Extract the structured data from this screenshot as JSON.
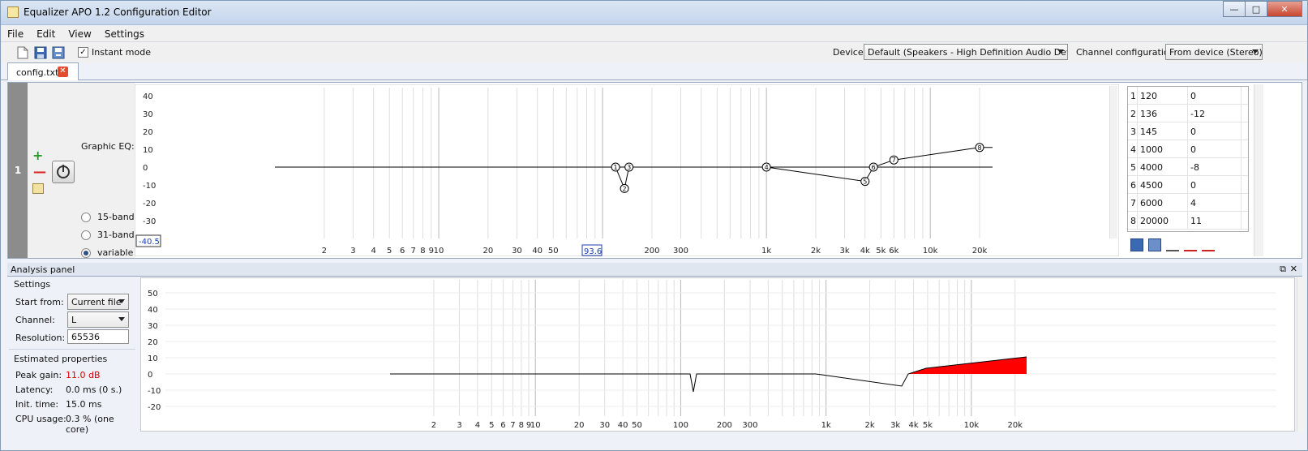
{
  "window": {
    "title": "Equalizer APO 1.2 Configuration Editor"
  },
  "menu": [
    "File",
    "Edit",
    "View",
    "Settings"
  ],
  "toolbar": {
    "instant_mode": "Instant mode",
    "device_label": "Device:",
    "device_value": "Default (Speakers - High Definition Audio Device)",
    "channel_label": "Channel configuration:",
    "channel_value": "From device (Stereo)"
  },
  "tab": {
    "name": "config.txt"
  },
  "filter": {
    "index": "1",
    "type_label": "Graphic EQ:",
    "radios": [
      "15-band",
      "31-band",
      "variable"
    ],
    "selected": "variable",
    "floor_value": "-40.5",
    "cursor_value": "93.6",
    "y_ticks": [
      "40",
      "30",
      "20",
      "10",
      "0",
      "-10",
      "-20",
      "-30"
    ],
    "x_ticks": [
      "2",
      "3",
      "4",
      "5",
      "6",
      "7",
      "8",
      "9",
      "10",
      "20",
      "30",
      "40",
      "50",
      "200",
      "300",
      "1k",
      "2k",
      "3k",
      "4k",
      "5k",
      "6k",
      "10k",
      "20k"
    ],
    "points": [
      {
        "n": 1,
        "freq": "120",
        "gain": "0"
      },
      {
        "n": 2,
        "freq": "136",
        "gain": "-12"
      },
      {
        "n": 3,
        "freq": "145",
        "gain": "0"
      },
      {
        "n": 4,
        "freq": "1000",
        "gain": "0"
      },
      {
        "n": 5,
        "freq": "4000",
        "gain": "-8"
      },
      {
        "n": 6,
        "freq": "4500",
        "gain": "0"
      },
      {
        "n": 7,
        "freq": "6000",
        "gain": "4"
      },
      {
        "n": 8,
        "freq": "20000",
        "gain": "11"
      }
    ]
  },
  "analysis": {
    "header": "Analysis panel",
    "settings_title": "Settings",
    "start_from_label": "Start from:",
    "start_from_value": "Current file",
    "channel_label": "Channel:",
    "channel_value": "L",
    "resolution_label": "Resolution:",
    "resolution_value": "65536",
    "estimated_title": "Estimated properties",
    "peak_gain_label": "Peak gain:",
    "peak_gain_value": "11.0 dB",
    "latency_label": "Latency:",
    "latency_value": "0.0 ms (0 s.)",
    "init_time_label": "Init. time:",
    "init_time_value": "15.0 ms",
    "cpu_label": "CPU usage:",
    "cpu_value": "0.3 % (one core)",
    "y_ticks": [
      "50",
      "40",
      "30",
      "20",
      "10",
      "0",
      "-10",
      "-20"
    ],
    "x_ticks": [
      "2",
      "3",
      "4",
      "5",
      "6",
      "7",
      "8",
      "9",
      "10",
      "20",
      "30",
      "40",
      "50",
      "100",
      "200",
      "300",
      "1k",
      "2k",
      "3k",
      "4k",
      "5k",
      "10k",
      "20k"
    ]
  }
}
